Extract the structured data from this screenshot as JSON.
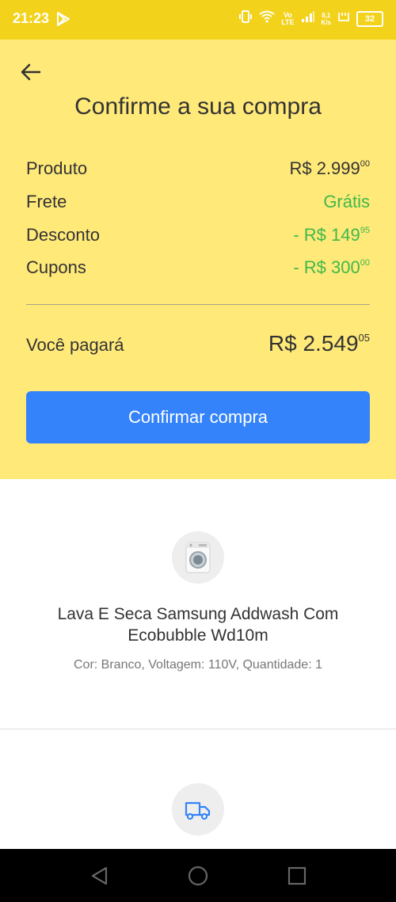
{
  "status_bar": {
    "time": "21:23",
    "volte_top": "Vo",
    "volte_bottom": "LTE",
    "net_speed_top": "8,1",
    "net_speed_bottom": "K/s",
    "battery": "32"
  },
  "header": {
    "title": "Confirme a sua compra"
  },
  "summary": {
    "rows": [
      {
        "label": "Produto",
        "value_main": "R$ 2.999",
        "value_cents": "00",
        "color": "#333333"
      },
      {
        "label": "Frete",
        "value_main": "Grátis",
        "value_cents": "",
        "color": "#3fb94a"
      },
      {
        "label": "Desconto",
        "value_main": "- R$ 149",
        "value_cents": "95",
        "color": "#3fb94a"
      },
      {
        "label": "Cupons",
        "value_main": "- R$ 300",
        "value_cents": "00",
        "color": "#3fb94a"
      }
    ],
    "total_label": "Você pagará",
    "total_main": "R$ 2.549",
    "total_cents": "05"
  },
  "confirm_button": {
    "label": "Confirmar compra",
    "color": "#3483fa"
  },
  "product": {
    "name": "Lava E Seca Samsung Addwash Com Ecobubble Wd10m",
    "attributes": "Cor: Branco, Voltagem: 110V, Quantidade: 1",
    "image_icon": "washing-machine-icon"
  },
  "delivery": {
    "icon": "truck-icon"
  },
  "colors": {
    "header_bg": "#ffe979",
    "status_bg": "#f3d21c",
    "green": "#3fb94a"
  }
}
